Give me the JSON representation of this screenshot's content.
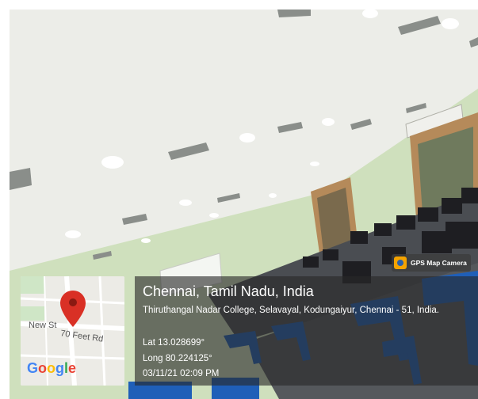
{
  "photo": {
    "description_icon": "classroom-computer-lab-photo",
    "colors": {
      "ceiling": "#ecede8",
      "wall": "#cfe0bd",
      "chair": "#1f5fb8",
      "desk": "#3a3a3a"
    }
  },
  "map": {
    "street_1": "New St",
    "street_2": "70 Feet Rd",
    "brand": [
      "G",
      "o",
      "o",
      "g",
      "l",
      "e"
    ],
    "pin_icon": "location-pin-icon",
    "pin_color": "#d93025"
  },
  "badge": {
    "label": "GPS Map Camera",
    "icon": "camera-app-icon"
  },
  "info": {
    "city": "Chennai, Tamil Nadu, India",
    "address": "Thiruthangal Nadar College, Selavayal, Kodungaiyur, Chennai - 51, India.",
    "lat": "Lat 13.028699°",
    "long": "Long 80.224125°",
    "datetime": "03/11/21 02:09 PM"
  }
}
